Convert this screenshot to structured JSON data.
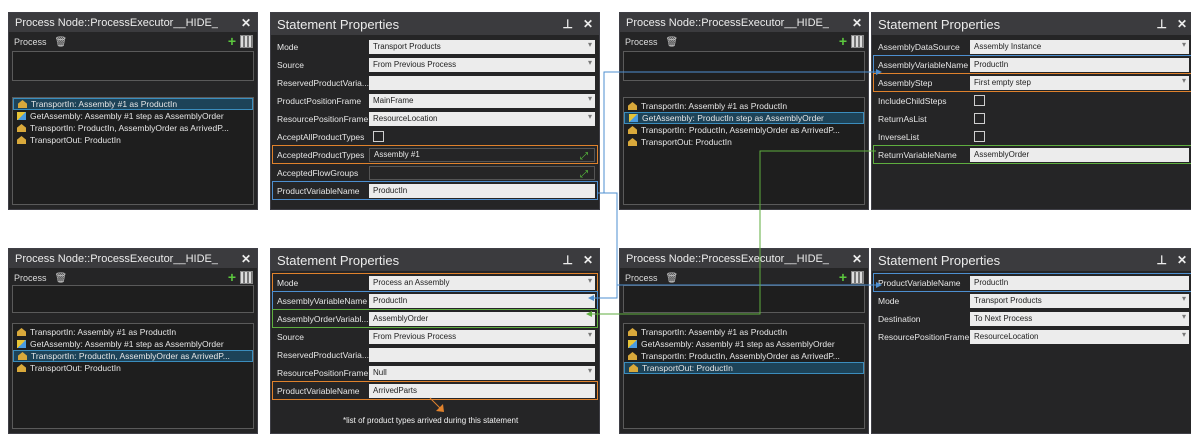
{
  "panels": [
    {
      "process_node": {
        "title": "Process Node::ProcessExecutor__HIDE_",
        "toolbar_label": "Process",
        "items": [
          {
            "icon": "transport",
            "label": "TransportIn: Assembly #1 as ProductIn",
            "selected": true
          },
          {
            "icon": "get",
            "label": "GetAssembly: Assembly #1 step as AssemblyOrder",
            "selected": false
          },
          {
            "icon": "transport",
            "label": "TransportIn: ProductIn, AssemblyOrder as ArrivedP...",
            "selected": false
          },
          {
            "icon": "transport",
            "label": "TransportOut: ProductIn",
            "selected": false
          }
        ]
      },
      "statement_properties": {
        "title": "Statement Properties",
        "rows": [
          {
            "key": "Mode",
            "value": "Transport Products",
            "kind": "dropdown"
          },
          {
            "key": "Source",
            "value": "From Previous Process",
            "kind": "dropdown"
          },
          {
            "key": "ReservedProductVaria...",
            "value": "",
            "kind": "text"
          },
          {
            "key": "ProductPositionFrame",
            "value": "MainFrame",
            "kind": "dropdown"
          },
          {
            "key": "ResourcePositionFrame",
            "value": "ResourceLocation",
            "kind": "dropdown"
          },
          {
            "key": "AcceptAllProductTypes",
            "value": "",
            "kind": "checkbox"
          },
          {
            "key": "AcceptedProductTypes",
            "value": "Assembly #1",
            "kind": "expand",
            "highlight": "orange"
          },
          {
            "key": "AcceptedFlowGroups",
            "value": "",
            "kind": "expand"
          },
          {
            "key": "ProductVariableName",
            "value": "ProductIn",
            "kind": "text",
            "highlight": "blue"
          }
        ]
      }
    },
    {
      "process_node": {
        "title": "Process Node::ProcessExecutor__HIDE_",
        "toolbar_label": "Process",
        "items": [
          {
            "icon": "transport",
            "label": "TransportIn: Assembly #1 as ProductIn",
            "selected": false
          },
          {
            "icon": "get",
            "label": "GetAssembly: ProductIn step as AssemblyOrder",
            "selected": true
          },
          {
            "icon": "transport",
            "label": "TransportIn: ProductIn, AssemblyOrder as ArrivedP...",
            "selected": false
          },
          {
            "icon": "transport",
            "label": "TransportOut: ProductIn",
            "selected": false
          }
        ]
      },
      "statement_properties": {
        "title": "Statement Properties",
        "rows": [
          {
            "key": "AssemblyDataSource",
            "value": "Assembly Instance",
            "kind": "dropdown"
          },
          {
            "key": "AssemblyVariableName",
            "value": "ProductIn",
            "kind": "text",
            "highlight": "blue"
          },
          {
            "key": "AssemblyStep",
            "value": "First empty step",
            "kind": "dropdown",
            "highlight": "orange"
          },
          {
            "key": "IncludeChildSteps",
            "value": "",
            "kind": "checkbox"
          },
          {
            "key": "ReturnAsList",
            "value": "",
            "kind": "checkbox"
          },
          {
            "key": "InverseList",
            "value": "",
            "kind": "checkbox"
          },
          {
            "key": "ReturnVariableName",
            "value": "AssemblyOrder",
            "kind": "text",
            "highlight": "green"
          }
        ]
      }
    },
    {
      "process_node": {
        "title": "Process Node::ProcessExecutor__HIDE_",
        "toolbar_label": "Process",
        "items": [
          {
            "icon": "transport",
            "label": "TransportIn: Assembly #1 as ProductIn",
            "selected": false
          },
          {
            "icon": "get",
            "label": "GetAssembly: Assembly #1 step as AssemblyOrder",
            "selected": false
          },
          {
            "icon": "transport",
            "label": "TransportIn: ProductIn, AssemblyOrder as ArrivedP...",
            "selected": true
          },
          {
            "icon": "transport",
            "label": "TransportOut: ProductIn",
            "selected": false
          }
        ]
      },
      "statement_properties": {
        "title": "Statement Properties",
        "rows": [
          {
            "key": "Mode",
            "value": "Process an Assembly",
            "kind": "dropdown",
            "highlight": "orange"
          },
          {
            "key": "AssemblyVariableName",
            "value": "ProductIn",
            "kind": "text",
            "highlight": "blue"
          },
          {
            "key": "AssemblyOrderVariabl...",
            "value": "AssemblyOrder",
            "kind": "text",
            "highlight": "green"
          },
          {
            "key": "Source",
            "value": "From Previous Process",
            "kind": "dropdown"
          },
          {
            "key": "ReservedProductVaria...",
            "value": "",
            "kind": "text"
          },
          {
            "key": "ResourcePositionFrame",
            "value": "Null",
            "kind": "dropdown"
          },
          {
            "key": "ProductVariableName",
            "value": "ArrivedParts",
            "kind": "text",
            "highlight": "orange"
          }
        ],
        "note": "*list of product types arrived during this statement"
      }
    },
    {
      "process_node": {
        "title": "Process Node::ProcessExecutor__HIDE_",
        "toolbar_label": "Process",
        "items": [
          {
            "icon": "transport",
            "label": "TransportIn: Assembly #1 as ProductIn",
            "selected": false
          },
          {
            "icon": "get",
            "label": "GetAssembly: Assembly #1 step as AssemblyOrder",
            "selected": false
          },
          {
            "icon": "transport",
            "label": "TransportIn: ProductIn, AssemblyOrder as ArrivedP...",
            "selected": false
          },
          {
            "icon": "transport",
            "label": "TransportOut: ProductIn",
            "selected": true
          }
        ]
      },
      "statement_properties": {
        "title": "Statement Properties",
        "rows": [
          {
            "key": "ProductVariableName",
            "value": "ProductIn",
            "kind": "text",
            "highlight": "blue"
          },
          {
            "key": "Mode",
            "value": "Transport Products",
            "kind": "dropdown"
          },
          {
            "key": "Destination",
            "value": "To Next Process",
            "kind": "dropdown"
          },
          {
            "key": "ResourcePositionFrame",
            "value": "ResourceLocation",
            "kind": "dropdown"
          }
        ]
      }
    }
  ],
  "colors": {
    "panel_bg": "#252526",
    "header_bg": "#3b3b3e",
    "highlight_orange": "#e0822c",
    "highlight_blue": "#4d8fd0",
    "highlight_green": "#5fae3f",
    "selection": "#1d4358"
  }
}
